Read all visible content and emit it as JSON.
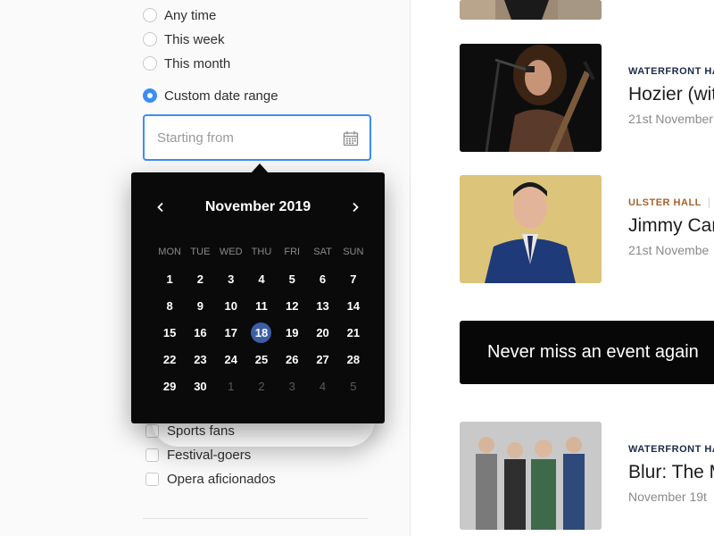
{
  "filters": {
    "time_options": [
      {
        "label": "Any time",
        "checked": false
      },
      {
        "label": "This week",
        "checked": false
      },
      {
        "label": "This month",
        "checked": false
      },
      {
        "label": "Custom date range",
        "checked": true
      }
    ],
    "date_input": {
      "placeholder": "Starting from",
      "value": "",
      "icon": "calendar-icon"
    },
    "audience_options": [
      {
        "label": "Sports fans",
        "checked": false
      },
      {
        "label": "Festival-goers",
        "checked": false
      },
      {
        "label": "Opera aficionados",
        "checked": false
      }
    ]
  },
  "calendar": {
    "month_label": "November 2019",
    "prev_icon": "chevron-left-icon",
    "next_icon": "chevron-right-icon",
    "weekdays": [
      "MON",
      "TUE",
      "WED",
      "THU",
      "FRI",
      "SAT",
      "SUN"
    ],
    "weeks": [
      [
        "1",
        "2",
        "3",
        "4",
        "5",
        "6",
        "7"
      ],
      [
        "8",
        "9",
        "10",
        "11",
        "12",
        "13",
        "14"
      ],
      [
        "15",
        "16",
        "17",
        "18",
        "19",
        "20",
        "21"
      ],
      [
        "22",
        "23",
        "24",
        "25",
        "26",
        "27",
        "28"
      ],
      [
        "29",
        "30",
        "1",
        "2",
        "3",
        "4",
        "5"
      ]
    ],
    "selected_day": "18",
    "selected_color": "#3c5ea6"
  },
  "events": [
    {
      "venue": "WATERFRONT HA",
      "venue_color": "#1b2a4a",
      "title": "Hozier (wit",
      "date": "21st November"
    },
    {
      "venue": "ULSTER HALL",
      "venue_color": "#a8622a",
      "title": "Jimmy Car",
      "date": "21st Novembe"
    },
    {
      "venue": "WATERFRONT HA",
      "venue_color": "#1b2a4a",
      "title": "Blur: The M",
      "date": "November 19t"
    }
  ],
  "banner": {
    "text": "Never miss an event again"
  },
  "colors": {
    "accent": "#3d8df5",
    "calendar_bg": "#0a0a0a",
    "banner_bg": "#070707"
  }
}
